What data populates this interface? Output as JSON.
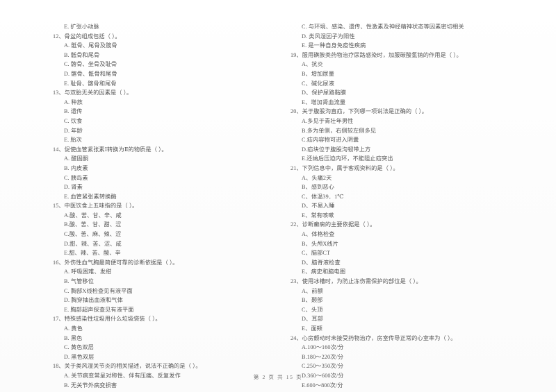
{
  "document": {
    "type": "scanned-exam-paper",
    "footer": "第 2 页 共 15 页"
  },
  "left_column": [
    {
      "id": "q11-tail",
      "stem": null,
      "options": [
        "E. 扩张小动脉"
      ]
    },
    {
      "id": "q12",
      "stem": "12、骨盆的组成包括（      ）。",
      "options": [
        "A. 骶骨、尾骨及髋骨",
        "B. 骶骨和尾骨",
        "C. 髂骨、坐骨及耻骨",
        "D. 髂骨、骶骨和尾骨",
        "E. 耻骨、髂骨和尾骨"
      ]
    },
    {
      "id": "q13",
      "stem": "13、与双胎无关的因素是（      ）。",
      "options": [
        "A. 种族",
        "B. 遗传",
        "C. 饮食",
        "D. 年龄",
        "E. 胎次"
      ]
    },
    {
      "id": "q14",
      "stem": "14、促使血管紧张素Ⅰ转换为Ⅱ的物质是（      ）。",
      "options": [
        "A. 醛固酮",
        "B. 内皮素",
        "C. 胰岛素",
        "D. 肾素",
        "E. 血管紧张素转换酶"
      ]
    },
    {
      "id": "q15",
      "stem": "15、中医饮食上五味指的是（      ）。",
      "options": [
        "A.酸、苦、甘、辛、咸",
        "B.酸、苦、甘、甜、涩",
        "C.酸、苦、麻、辣、涩",
        "D.甜、辣、苦、涩、咸",
        "E.甜、辣、苦、酸、辛"
      ]
    },
    {
      "id": "q16",
      "stem": "16、外伤性血气胸最简便可靠的诊断依据是（      ）。",
      "options": [
        "A. 呼吸困难、发绀",
        "B. 气管移位",
        "C. 胸部X线检查见有液平面",
        "D. 胸穿抽出血液和气体",
        "E. 胸部超声探查见有液平面"
      ]
    },
    {
      "id": "q17",
      "stem": "17、特殊感染性垃圾用什么垃圾袋装（      ）。",
      "options": [
        "A. 黄色",
        "B. 黑色",
        "C. 黄色双层",
        "D. 黑色双层"
      ]
    },
    {
      "id": "q18",
      "stem": "18、关于类风湿关节炎的相关描述，说法不正确的是（      ）。",
      "options": [
        "A. 关节病变常呈对称性、伴有压痛、反复发作",
        "B. 无关节外病变损害"
      ]
    }
  ],
  "right_column": [
    {
      "id": "q18-tail",
      "stem": null,
      "options": [
        "C. 与环境、感染、遗传、性激素及神经精神状态等因素密切相关",
        "D. 类风湿因子为阳性",
        "E. 是一种自身免疫性疾病"
      ]
    },
    {
      "id": "q19",
      "stem": "19、服用磺胺类药物治疗尿路感染时，加服碳酸氢钠的作用是（      ）。",
      "options": [
        "A、抗炎",
        "B、增加尿量",
        "C、碱化尿液",
        "D、保护尿路黏膜",
        "E、增加肾血流量"
      ]
    },
    {
      "id": "q20",
      "stem": "20、关于腹股沟直疝，下列哪一项说法是正确的（      ）。",
      "options": [
        "A.多见于青壮年男性",
        "B.多为单侧，右侧较左侧多见",
        "C.疝内容物可进入阴囊",
        "D.疝块位于腹股沟韧带上方",
        "E.还纳后压迫内环，不能阻止疝突出"
      ]
    },
    {
      "id": "q21",
      "stem": "21、下列信息中，属于客观资料的是（      ）。",
      "options": [
        "A、头痛2天",
        "B、感到恶心",
        "C、体温39．1℃",
        "D、不易入睡",
        "E、常有咳嗽"
      ]
    },
    {
      "id": "q22",
      "stem": "22、诊断癫痫的主要依据是（      ）。",
      "options": [
        "A、体格检查",
        "B、头颅X线片",
        "C、脑部CT",
        "D、脑脊液检查",
        "E、病史和脑电图"
      ]
    },
    {
      "id": "q23",
      "stem": "23、使用冰槽时，为防止冻伤需保护的部位是（      ）。",
      "options": [
        "A、前额",
        "B、颞部",
        "C、头顶",
        "D、耳部",
        "E、面颊"
      ]
    },
    {
      "id": "q24",
      "stem": "24、心房颤动时未接受药物治疗，房室传导正常的心室率为（      ）。",
      "options": [
        "A.100～160次/分",
        "B.180～220次/分",
        "C.250～350次/分",
        "D.360～600次/分",
        "E.600～800次/分"
      ]
    }
  ]
}
